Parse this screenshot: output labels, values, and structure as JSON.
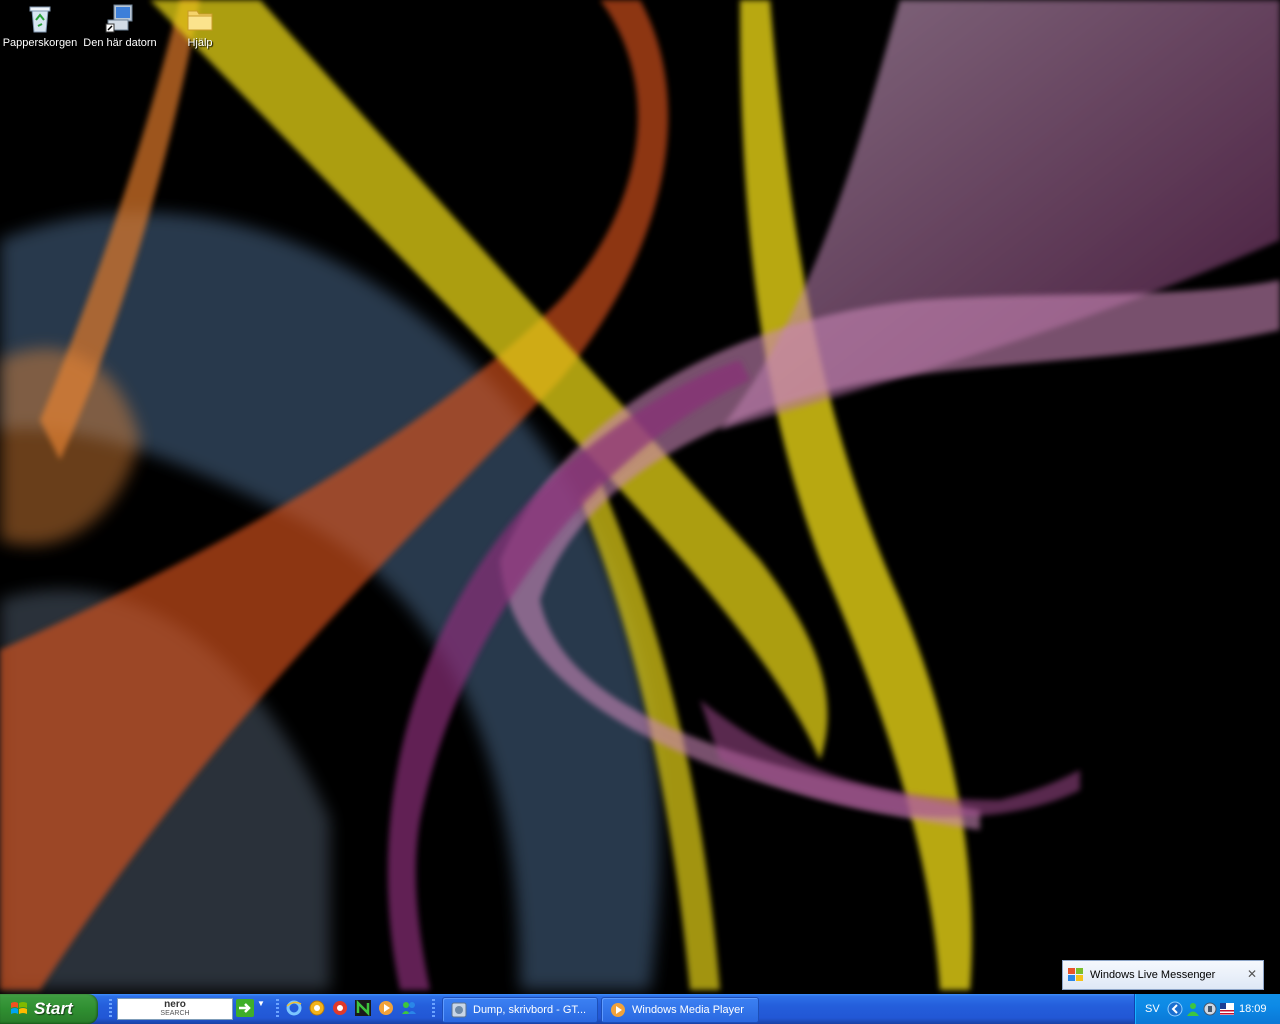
{
  "desktop_icons": [
    {
      "label": "Papperskorgen",
      "icon": "recycle-bin-icon"
    },
    {
      "label": "Den här datorn",
      "icon": "my-computer-icon"
    },
    {
      "label": "Hjälp",
      "icon": "folder-icon"
    }
  ],
  "taskbar": {
    "start_label": "Start",
    "nero_search": {
      "line1": "nero",
      "line2": "SEARCH"
    },
    "tasks": [
      {
        "label": "Dump, skrivbord - GT...",
        "icon": "image-editor-icon"
      },
      {
        "label": "Windows Media Player",
        "icon": "media-player-icon"
      }
    ],
    "tray": {
      "language": "SV",
      "clock": "18:09"
    }
  },
  "notification": {
    "title": "Windows Live Messenger"
  },
  "colors": {
    "taskbar": "#245edb",
    "start": "#2f8f31",
    "tray": "#0d8ae6"
  }
}
